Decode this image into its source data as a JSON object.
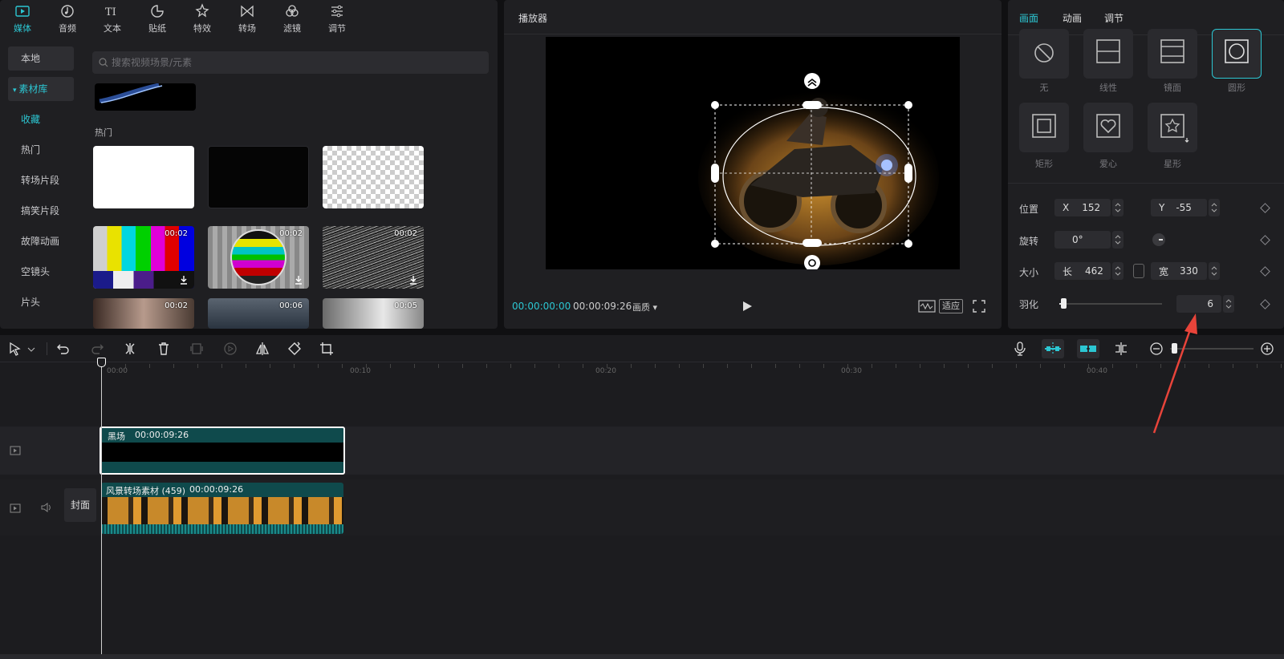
{
  "media_panel": {
    "tabs": [
      {
        "label": "媒体",
        "icon": "media-icon"
      },
      {
        "label": "音频",
        "icon": "audio-icon"
      },
      {
        "label": "文本",
        "icon": "text-icon"
      },
      {
        "label": "贴纸",
        "icon": "sticker-icon"
      },
      {
        "label": "特效",
        "icon": "effects-icon"
      },
      {
        "label": "转场",
        "icon": "transition-icon"
      },
      {
        "label": "滤镜",
        "icon": "filter-icon"
      },
      {
        "label": "调节",
        "icon": "adjust-icon"
      }
    ],
    "sidebar": [
      "本地",
      "素材库",
      "收藏",
      "热门",
      "转场片段",
      "搞笑片段",
      "故障动画",
      "空镜头",
      "片头"
    ],
    "search_placeholder": "搜索视频场景/元素",
    "section_title": "热门",
    "thumb_durations": [
      "00:02",
      "00:02",
      "00:02",
      "00:02",
      "00:06",
      "00:05"
    ]
  },
  "player": {
    "title": "播放器",
    "current_time": "00:00:00:00",
    "total_time": "00:00:09:26",
    "quality_label": "画质",
    "fit_label": "适应"
  },
  "properties": {
    "tabs": [
      "画面",
      "动画",
      "调节"
    ],
    "mask_shapes": [
      "无",
      "线性",
      "镜面",
      "圆形",
      "矩形",
      "爱心",
      "星形"
    ],
    "position_label": "位置",
    "x_label": "X",
    "x_value": "152",
    "y_label": "Y",
    "y_value": "-55",
    "rotation_label": "旋转",
    "rotation_value": "0°",
    "size_label": "大小",
    "length_label": "长",
    "length_value": "462",
    "width_label": "宽",
    "width_value": "330",
    "feather_label": "羽化",
    "feather_value": "6",
    "accent": "#2cc6d2"
  },
  "timeline": {
    "ruler_marks": [
      "00:00",
      "00:10",
      "00:20",
      "00:30",
      "00:40"
    ],
    "clip1_name": "黑场",
    "clip1_duration": "00:00:09:26",
    "clip2_name": "风景转场素材 (459)",
    "clip2_duration": "00:00:09:26",
    "cover_label": "封面",
    "annotation_color": "#e8443a"
  }
}
